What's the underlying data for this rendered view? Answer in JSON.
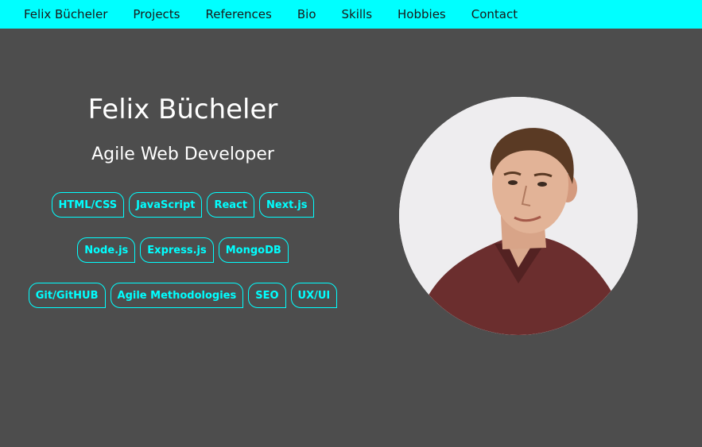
{
  "nav": {
    "items": [
      {
        "label": "Felix Bücheler"
      },
      {
        "label": "Projects"
      },
      {
        "label": "References"
      },
      {
        "label": "Bio"
      },
      {
        "label": "Skills"
      },
      {
        "label": "Hobbies"
      },
      {
        "label": "Contact"
      }
    ]
  },
  "hero": {
    "name": "Felix Bücheler",
    "role": "Agile Web Developer",
    "skill_rows": [
      [
        "HTML/CSS",
        "JavaScript",
        "React",
        "Next.js"
      ],
      [
        "Node.js",
        "Express.js",
        "MongoDB"
      ],
      [
        "Git/GitHUB",
        "Agile Methodologies",
        "SEO",
        "UX/UI"
      ]
    ]
  },
  "colors": {
    "accent": "#00ffff",
    "background": "#4d4d4d",
    "text": "#ffffff"
  }
}
